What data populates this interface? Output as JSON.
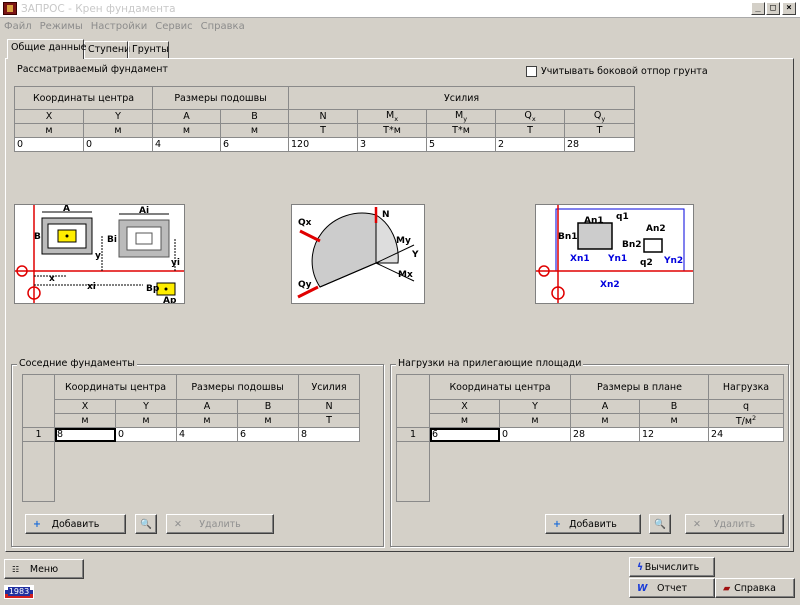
{
  "window": {
    "title": "ЗАПРОС - Крен фундамента",
    "minimize": "_",
    "maximize": "□",
    "close": "×"
  },
  "menu": [
    "Файл",
    "Режимы",
    "Настройки",
    "Сервис",
    "Справка"
  ],
  "tabs": [
    "Общие данные",
    "Ступени",
    "Грунты"
  ],
  "main": {
    "section_label": "Рассматриваемый фундамент",
    "checkbox_label": "Учитывать боковой отпор грунта",
    "checkbox_checked": false,
    "groups": {
      "center": "Координаты центра",
      "size": "Размеры подошвы",
      "forces": "Усилия"
    },
    "columns": [
      {
        "h": "X",
        "s": "",
        "u": "м",
        "v": "0"
      },
      {
        "h": "Y",
        "s": "",
        "u": "м",
        "v": "0"
      },
      {
        "h": "A",
        "s": "",
        "u": "м",
        "v": "4"
      },
      {
        "h": "B",
        "s": "",
        "u": "м",
        "v": "6"
      },
      {
        "h": "N",
        "s": "",
        "u": "Т",
        "v": "120"
      },
      {
        "h": "M",
        "s": "x",
        "u": "Т*м",
        "v": "3"
      },
      {
        "h": "M",
        "s": "y",
        "u": "Т*м",
        "v": "5"
      },
      {
        "h": "Q",
        "s": "x",
        "u": "Т",
        "v": "2"
      },
      {
        "h": "Q",
        "s": "y",
        "u": "Т",
        "v": "28"
      }
    ]
  },
  "diagrams": {
    "left": {
      "A": "A",
      "Ai": "Ai",
      "B": "B",
      "Bi": "Bi",
      "y": "y",
      "yi": "yi",
      "x": "x",
      "xi": "xi",
      "Bp": "Bp",
      "Ap": "Ap"
    },
    "center": {
      "Qx": "Qx",
      "N": "N",
      "My": "My",
      "Y": "Y",
      "Mx": "Mx",
      "Qy": "Qy"
    },
    "right": {
      "An1": "An1",
      "q1": "q1",
      "An2": "An2",
      "Bn1": "Bn1",
      "Bn2": "Bn2",
      "Xn1": "Xn1",
      "Yn1": "Yn1",
      "q2": "q2",
      "Yn2": "Yn2",
      "Xn2": "Xn2"
    }
  },
  "neighbors": {
    "title": "Соседние фундаменты",
    "groups": {
      "center": "Координаты центра",
      "size": "Размеры подошвы",
      "forces": "Усилия"
    },
    "headers": [
      "X",
      "Y",
      "A",
      "B",
      "N"
    ],
    "units": [
      "м",
      "м",
      "м",
      "м",
      "Т"
    ],
    "rows": [
      {
        "n": "1",
        "values": [
          "8",
          "0",
          "4",
          "6",
          "8"
        ]
      }
    ],
    "add_label": "Добавить",
    "delete_label": "Удалить"
  },
  "loads": {
    "title": "Нагрузки на прилегающие площади",
    "groups": {
      "center": "Координаты центра",
      "size": "Размеры в плане",
      "load": "Нагрузка"
    },
    "headers": [
      "X",
      "Y",
      "A",
      "B",
      "q"
    ],
    "units": [
      "м",
      "м",
      "м",
      "м",
      "Т/м"
    ],
    "unit_sup": "2",
    "rows": [
      {
        "n": "1",
        "values": [
          "6",
          "0",
          "28",
          "12",
          "24"
        ]
      }
    ],
    "add_label": "Добавить",
    "delete_label": "Удалить"
  },
  "bottom": {
    "menu_label": "Меню",
    "calc_label": "Вычислить",
    "report_label": "Отчет",
    "help_label": "Справка",
    "year_badge": "1983"
  },
  "colors": {
    "accent_red": "#e00000",
    "image_blue": "#0000dd",
    "yellow": "#ffee00",
    "badge_blue": "#2030a0"
  }
}
